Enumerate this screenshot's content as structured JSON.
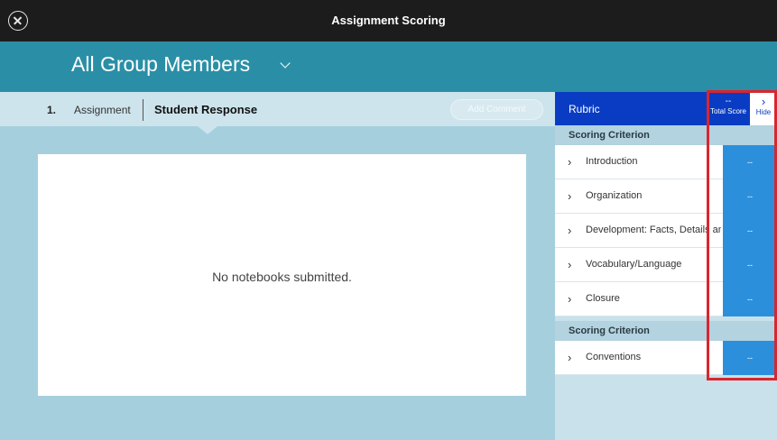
{
  "window": {
    "title": "Assignment Scoring"
  },
  "group": {
    "title": "All Group Members"
  },
  "subnav": {
    "number": "1.",
    "tab_assignment": "Assignment",
    "tab_student_response": "Student Response",
    "add_comment": "Add Comment"
  },
  "notebook": {
    "message": "No notebooks submitted."
  },
  "rubric": {
    "title": "Rubric",
    "total_score_value": "--",
    "total_score_label": "Total Score",
    "hide_label": "Hide",
    "sections": [
      {
        "heading": "Scoring Criterion",
        "criteria": [
          {
            "label": "Introduction",
            "score": "--"
          },
          {
            "label": "Organization",
            "score": "--"
          },
          {
            "label": "Development: Facts, Details and",
            "score": "--"
          },
          {
            "label": "Vocabulary/Language",
            "score": "--"
          },
          {
            "label": "Closure",
            "score": "--"
          }
        ]
      },
      {
        "heading": "Scoring Criterion",
        "criteria": [
          {
            "label": "Conventions",
            "score": "--"
          }
        ]
      }
    ]
  },
  "colors": {
    "titlebar": "#1c1c1c",
    "group_header": "#2a8fa6",
    "rubric_header": "#0a3cc3",
    "score_cell": "#2b8fdc",
    "highlight_box": "#d9262f"
  },
  "icons": {
    "close": "close-circle-icon",
    "group_dropdown": "chevron-down-icon",
    "criterion_expand": "chevron-right-icon"
  }
}
